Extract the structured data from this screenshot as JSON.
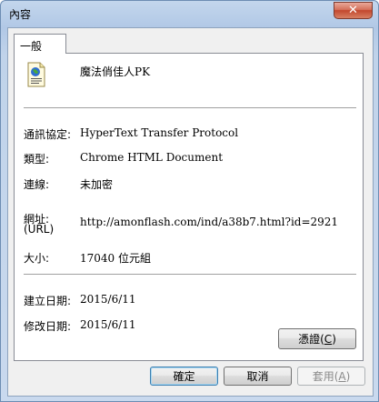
{
  "window": {
    "title": "內容",
    "close_glyph": "✕"
  },
  "tabs": [
    {
      "label": "一般"
    }
  ],
  "file": {
    "name": "魔法俏佳人PK",
    "icon": "html-document-icon"
  },
  "properties": {
    "protocol": {
      "label": "通訊協定:",
      "value": "HyperText Transfer Protocol"
    },
    "type": {
      "label": "類型:",
      "value": "Chrome HTML Document"
    },
    "connection": {
      "label": "連線:",
      "value": "未加密"
    },
    "address": {
      "label_line1": "網址:",
      "label_line2": "(URL)",
      "value": "http://amonflash.com/ind/a38b7.html?id=2921"
    },
    "size": {
      "label": "大小:",
      "value": "17040 位元組"
    },
    "created": {
      "label": "建立日期:",
      "value": "2015/6/11"
    },
    "modified": {
      "label": "修改日期:",
      "value": "2015/6/11"
    }
  },
  "buttons": {
    "certificates": {
      "label": "憑證(",
      "key": "C",
      "suffix": ")"
    },
    "ok": "確定",
    "cancel": "取消",
    "apply": {
      "label": "套用(",
      "key": "A",
      "suffix": ")"
    }
  }
}
